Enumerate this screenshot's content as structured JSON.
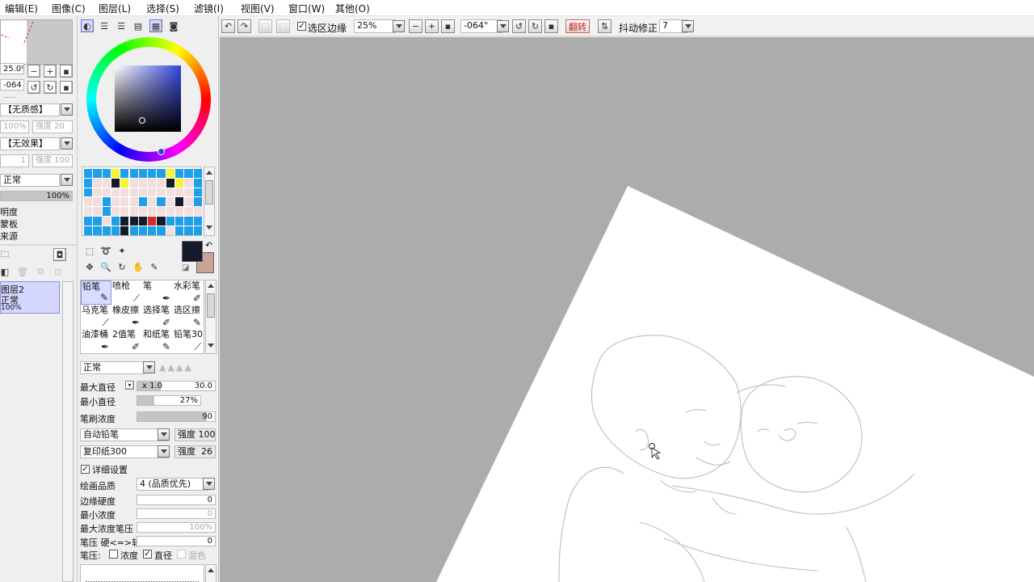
{
  "menubar": {
    "items": [
      "编辑(E)",
      "图像(C)",
      "图层(L)",
      "选择(S)",
      "滤镜(I)",
      "视图(V)",
      "窗口(W)",
      "其他(O)"
    ]
  },
  "navigator": {
    "zoom": "25.0%",
    "angle": "-064",
    "texture": "【无质感】",
    "texture_opacity": "100%",
    "texture_strength": "强度 20",
    "effect": "【无效果】",
    "effect_value": "1",
    "effect_strength": "强度 100",
    "blend_mode": "正常",
    "opacity": "100%",
    "options": [
      "明度",
      "蒙板",
      "来源"
    ],
    "layer_name": "图层2",
    "layer_mode": "正常",
    "layer_opacity": "100%"
  },
  "color": {
    "primary": "#151a2a",
    "secondary": "#c9a396"
  },
  "palette_rows": [
    [
      "#1e9fe8",
      "#1e9fe8",
      "#1e9fe8",
      "#f5f531",
      "#1e9fe8",
      "#1e9fe8",
      "#1e9fe8",
      "#1e9fe8",
      "#1e9fe8",
      "#f5f531",
      "#1e9fe8",
      "#1e9fe8",
      "#1e9fe8"
    ],
    [
      "#1e9fe8",
      "#f3dede",
      "#f3dede",
      "#151a2a",
      "#f5f531",
      "#f3dede",
      "#f3dede",
      "#f3dede",
      "#f3dede",
      "#151a2a",
      "#f5f531",
      "#f3dede",
      "#1e9fe8"
    ],
    [
      "#1e9fe8",
      "#f3dede",
      "#f3dede",
      "#f3dede",
      "#f3dede",
      "#f3dede",
      "#f3dede",
      "#f3dede",
      "#f3dede",
      "#f3dede",
      "#f3dede",
      "#f3dede",
      "#1e9fe8"
    ],
    [
      "#f3dede",
      "#f3dede",
      "#1e9fe8",
      "#f3dede",
      "#f3dede",
      "#f3dede",
      "#1e9fe8",
      "#f3dede",
      "#1e9fe8",
      "#f3dede",
      "#151a2a",
      "#f3dede",
      "#1e9fe8"
    ],
    [
      "#f3dede",
      "#f3dede",
      "#1e9fe8",
      "#f3dede",
      "#f3dede",
      "#f3dede",
      "#f3dede",
      "#f3dede",
      "#f3dede",
      "#f3dede",
      "#f3dede",
      "#f3dede",
      "#f3dede"
    ],
    [
      "#1e9fe8",
      "#1e9fe8",
      "#f3dede",
      "#1e9fe8",
      "#151a2a",
      "#151a2a",
      "#151a2a",
      "#d42a2a",
      "#151a2a",
      "#1e9fe8",
      "#1e9fe8",
      "#1e9fe8",
      "#1e9fe8"
    ],
    [
      "#1e9fe8",
      "#1e9fe8",
      "#1e9fe8",
      "#1e9fe8",
      "#151a2a",
      "#1e9fe8",
      "#1e9fe8",
      "#1e9fe8",
      "#1e9fe8",
      "#f3dede",
      "#1e9fe8",
      "#1e9fe8",
      "#1e9fe8"
    ]
  ],
  "tools": [
    [
      "铅笔",
      "喷枪",
      "笔",
      "水彩笔"
    ],
    [
      "马克笔",
      "橡皮擦",
      "选择笔",
      "选区擦"
    ],
    [
      "油漆桶",
      "2值笔",
      "和纸笔",
      "铅笔30"
    ]
  ],
  "brush": {
    "blend": "正常",
    "max_size_label": "最大直径",
    "max_size_mult": "x 1.0",
    "max_size_value": "30.0",
    "min_size_label": "最小直径",
    "min_size_value": "27%",
    "min_size_pct": 0.27,
    "density_label": "笔刷浓度",
    "density_value": "90",
    "density_pct": 0.9,
    "shape": "自动铅笔",
    "shape_strength": "强度 100",
    "texture": "复印纸300",
    "texture_strength": "强度",
    "texture_strength_value": "26",
    "detail_label": "详细设置",
    "quality_label": "绘画品质",
    "quality_value": "4 (品质优先)",
    "edge_label": "边缘硬度",
    "edge_value": "0",
    "min_density_label": "最小浓度",
    "min_density_value": "0",
    "max_pressure_label": "最大浓度笔压",
    "max_pressure_value": "100%",
    "pressure_soft_label": "笔压 硬<=>软",
    "pressure_soft_value": "0",
    "pressure_label": "笔压:",
    "pressure_density": "浓度",
    "pressure_size": "直径",
    "pressure_blend": "混色"
  },
  "toolbar": {
    "selection_edge_label": "选区边缘",
    "zoom": "25%",
    "angle": "-064°",
    "flip_label": "翻转",
    "stabilizer_label": "抖动修正",
    "stabilizer_value": "7"
  }
}
